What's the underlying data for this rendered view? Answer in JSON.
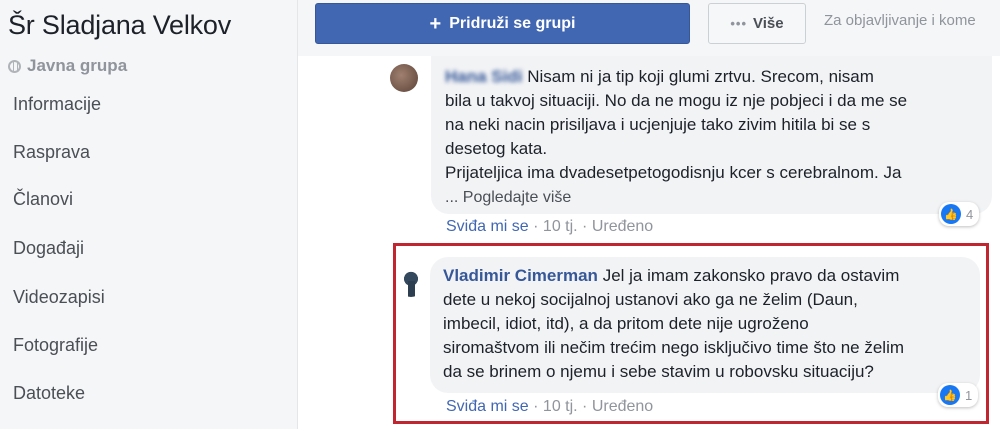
{
  "sidebar": {
    "title": "Šr Sladjana Velkov",
    "privacy": "Javna grupa",
    "items": [
      "Informacije",
      "Rasprava",
      "Članovi",
      "Događaji",
      "Videozapisi",
      "Fotografije",
      "Datoteke"
    ]
  },
  "topbar": {
    "join_label": "Pridruži se grupi",
    "more_label": "Više",
    "hint": "Za objavljivanje i kome"
  },
  "comments": [
    {
      "author": "Hana Sidi",
      "text_lines": [
        "Nisam ni ja tip koji glumi zrtvu. Srecom, nisam",
        "bila u takvoj situaciji. No da ne mogu iz nje pobjeci i da me se",
        "na neki nacin prisiljava i ucjenjuje tako zivim hitila bi se s",
        "desetog kata.",
        "Prijateljica ima dvadesetpetogodisnju kcer s cerebralnom. Ja"
      ],
      "see_more": "... Pogledajte više",
      "like_label": "Sviđa mi se",
      "time": "10 tj.",
      "edited": "Uređeno",
      "reactions": "4"
    },
    {
      "author": "Vladimir Cimerman",
      "text_first": "Jel ja imam zakonsko pravo da ostavim",
      "text_lines": [
        "dete u nekoj socijalnoj ustanovi ako ga ne želim (Daun,",
        "imbecil, idiot, itd), a da pritom dete nije ugroženo",
        "siromaštvom ili nečim trećim nego isključivo time što ne želim",
        "da se brinem o njemu i sebe stavim u robovsku situaciju?"
      ],
      "like_label": "Sviđa mi se",
      "time": "10 tj.",
      "edited": "Uređeno",
      "reactions": "1"
    }
  ],
  "colors": {
    "brand": "#4267b2",
    "link": "#365899",
    "highlight": "#c0262f"
  }
}
